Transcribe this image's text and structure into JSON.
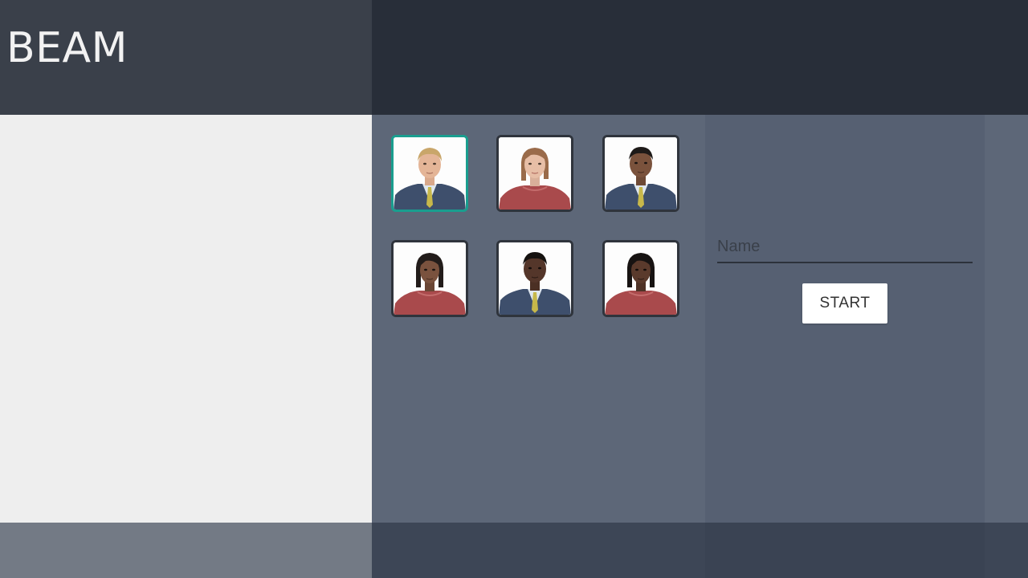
{
  "app": {
    "title": "BEAM"
  },
  "avatars": [
    {
      "name": "avatar-blond-man",
      "selected": true
    },
    {
      "name": "avatar-light-woman",
      "selected": false
    },
    {
      "name": "avatar-dark-man-1",
      "selected": false
    },
    {
      "name": "avatar-dark-woman-1",
      "selected": false
    },
    {
      "name": "avatar-dark-man-2",
      "selected": false
    },
    {
      "name": "avatar-dark-woman-2",
      "selected": false
    }
  ],
  "form": {
    "name_placeholder": "Name",
    "name_value": "",
    "start_label": "START"
  },
  "colors": {
    "selected_border": "#1a9e8f",
    "header_left": "#3a404a",
    "header_right": "#282e39",
    "panel_main": "#5d6778"
  }
}
